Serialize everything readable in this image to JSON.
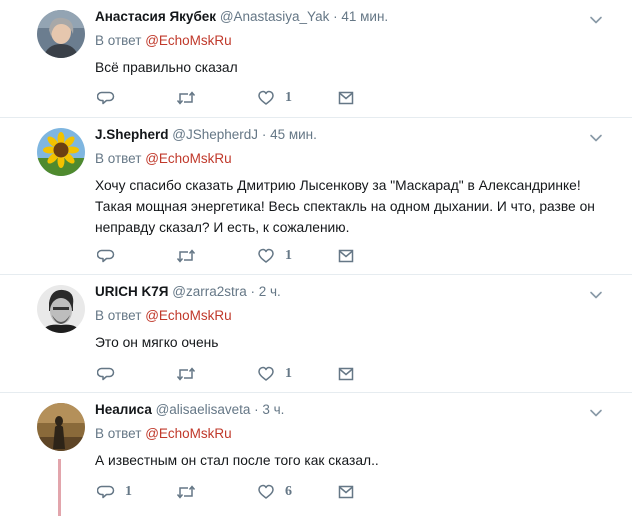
{
  "reply_to_label": "В ответ",
  "tweets": [
    {
      "name": "Анастасия Якубек",
      "handle": "@Anastasiya_Yak",
      "separator": "·",
      "time": "41 мин.",
      "reply_to": "@EchoMskRu",
      "text": "Всё правильно сказал",
      "reply_count": "",
      "retweet_count": "",
      "like_count": "1"
    },
    {
      "name": "J.Shepherd",
      "handle": "@JShepherdJ",
      "separator": "·",
      "time": "45 мин.",
      "reply_to": "@EchoMskRu",
      "text": "Хочу спасибо сказать Дмитрию Лысенкову за \"Маскарад\" в Александринке! Такая мощная энергетика! Весь спектакль на одном дыхании. И что, разве он неправду сказал? И есть, к сожалению.",
      "reply_count": "",
      "retweet_count": "",
      "like_count": "1"
    },
    {
      "name": "URICH K7Я",
      "handle": "@zarra2stra",
      "separator": "·",
      "time": "2 ч.",
      "reply_to": "@EchoMskRu",
      "text": "Это он мягко очень",
      "reply_count": "",
      "retweet_count": "",
      "like_count": "1"
    },
    {
      "name": "Неалиса",
      "handle": "@alisaelisaveta",
      "separator": "·",
      "time": "3 ч.",
      "reply_to": "@EchoMskRu",
      "text": "А известным он стал после того как сказал..",
      "reply_count": "1",
      "retweet_count": "",
      "like_count": "6"
    }
  ],
  "icons": {
    "reply": "reply-icon",
    "retweet": "retweet-icon",
    "like": "heart-icon",
    "dm": "envelope-icon",
    "caret": "chevron-down-icon"
  },
  "colors": {
    "link": "#c0392b",
    "secondary_text": "#657786",
    "primary_text": "#14171a",
    "divider": "#e6ecf0",
    "thread_line": "#e2a5ac"
  }
}
